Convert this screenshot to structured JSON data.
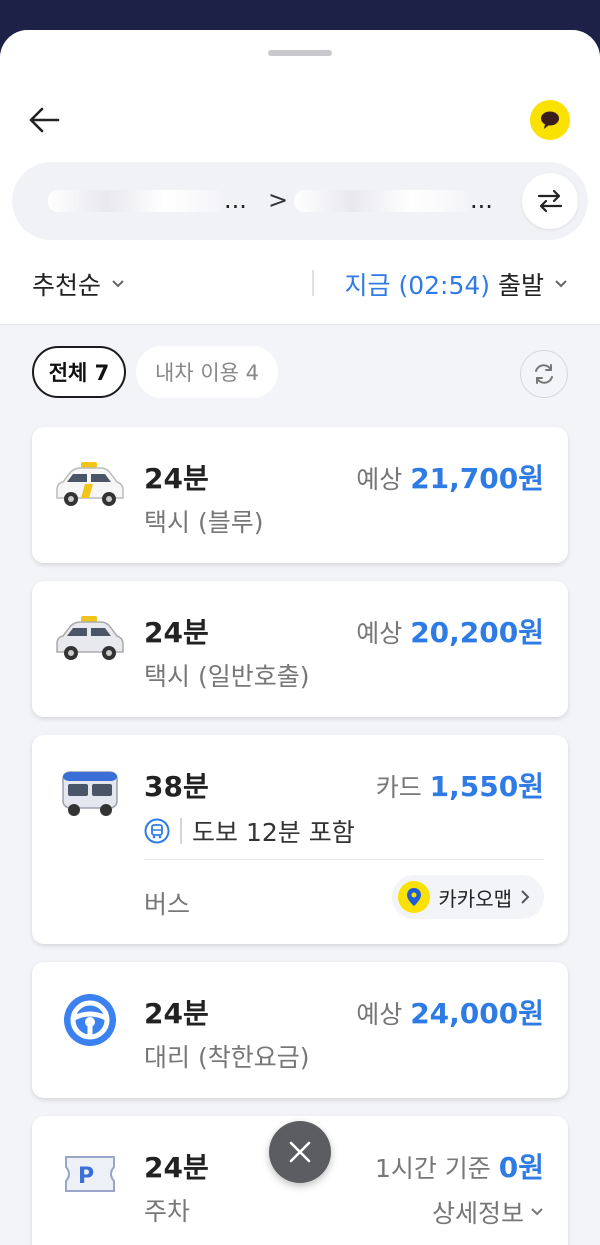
{
  "header": {
    "back_icon": "arrow-left-icon",
    "chat_icon": "speech-bubble-icon"
  },
  "route": {
    "from_suffix": "...",
    "arrow": ">",
    "to_suffix": "...",
    "swap_icon": "swap-arrows-icon"
  },
  "sort": {
    "label": "추천순"
  },
  "departure": {
    "time_label": "지금 (02:54)",
    "suffix": "출발"
  },
  "filters": {
    "all": "전체 7",
    "own_car": "내차 이용 4"
  },
  "routes": [
    {
      "time": "24분",
      "name": "택시 (블루)",
      "price_prefix": "예상",
      "price": "21,700원",
      "icon": "blue-taxi-icon"
    },
    {
      "time": "24분",
      "name": "택시 (일반호출)",
      "price_prefix": "예상",
      "price": "20,200원",
      "icon": "taxi-icon"
    },
    {
      "time": "38분",
      "walk": "도보 12분 포함",
      "name": "버스",
      "price_prefix": "카드",
      "price": "1,550원",
      "icon": "bus-icon",
      "kakaomap": "카카오맵"
    },
    {
      "time": "24분",
      "name": "대리 (착한요금)",
      "price_prefix": "예상",
      "price": "24,000원",
      "icon": "steering-wheel-icon"
    },
    {
      "time": "24분",
      "name": "주차",
      "price_prefix": "1시간 기준",
      "price": "0원",
      "icon": "parking-ticket-icon",
      "detail": "상세정보"
    }
  ],
  "colors": {
    "accent": "#2f7be6",
    "kakao_yellow": "#fae100",
    "status_bar": "#1d2147"
  }
}
